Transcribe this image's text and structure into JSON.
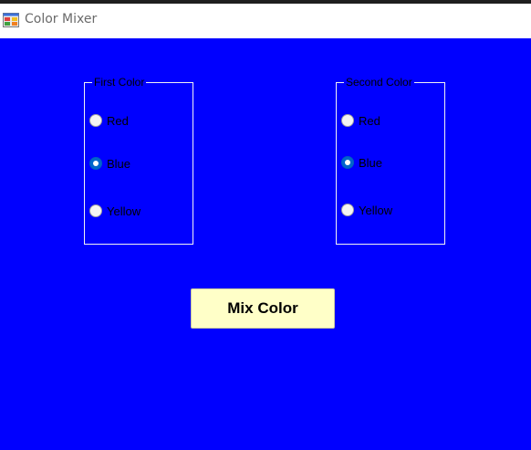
{
  "window": {
    "title": "Color Mixer",
    "icon": "app-window-icon"
  },
  "colors": {
    "client_background": "#0000ff",
    "button_background": "#ffffc8",
    "radio_checked": "#0066cc"
  },
  "first_color": {
    "legend": "First Color",
    "options": [
      {
        "label": "Red",
        "checked": false
      },
      {
        "label": "Blue",
        "checked": true
      },
      {
        "label": "Yellow",
        "checked": false
      }
    ]
  },
  "second_color": {
    "legend": "Second Color",
    "options": [
      {
        "label": "Red",
        "checked": false
      },
      {
        "label": "Blue",
        "checked": true
      },
      {
        "label": "Yellow",
        "checked": false
      }
    ]
  },
  "mix_button": {
    "label": "Mix Color"
  }
}
